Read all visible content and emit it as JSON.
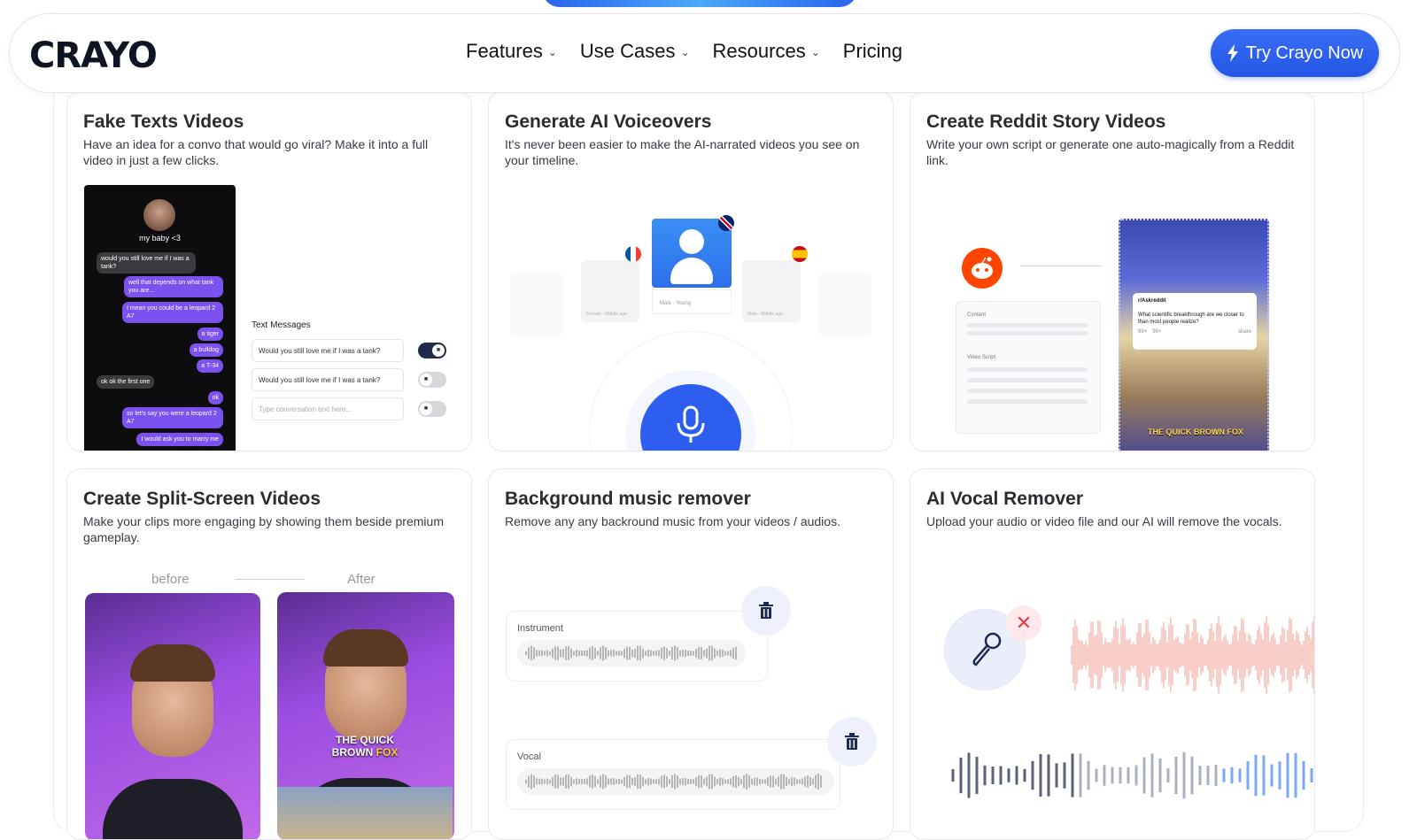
{
  "nav": {
    "logo": "CRAYO",
    "items": [
      {
        "label": "Features",
        "dropdown": true
      },
      {
        "label": "Use Cases",
        "dropdown": true
      },
      {
        "label": "Resources",
        "dropdown": true
      },
      {
        "label": "Pricing",
        "dropdown": false
      }
    ],
    "cta_label": "Try Crayo Now"
  },
  "colors": {
    "accent": "#2a5ee8",
    "reddit": "#ff4500",
    "chat_purple": "#7b52f0"
  },
  "cards": [
    {
      "title": "Fake Texts Videos",
      "desc": "Have an idea for a convo that would go viral? Make it into a full video in just a few clicks.",
      "phone": {
        "contact": "my baby <3",
        "messages": [
          {
            "side": "left",
            "text": "would you still love me if I was a tank?"
          },
          {
            "side": "right",
            "text": "well that depends on what tank you are..."
          },
          {
            "side": "right",
            "text": "I mean you could be a leopard 2 A7"
          },
          {
            "side": "right",
            "text": "a tiger"
          },
          {
            "side": "right",
            "text": "a bulldog"
          },
          {
            "side": "right",
            "text": "a T-34"
          },
          {
            "side": "left",
            "text": "ok ok the first one"
          },
          {
            "side": "right",
            "text": "ok"
          },
          {
            "side": "right",
            "text": "so let's say you were a leopard 2 A7"
          },
          {
            "side": "right",
            "text": "I would ask you to marry me"
          }
        ]
      },
      "text_messages": {
        "label": "Text Messages",
        "inputs": [
          {
            "value": "Would you still love me if I was a tank?",
            "toggle_on": true
          },
          {
            "value": "Would you still love me if I was a tank?",
            "toggle_on": false
          },
          {
            "placeholder": "Type conversation text here...",
            "toggle_on": false
          }
        ]
      }
    },
    {
      "title": "Generate AI Voiceovers",
      "desc": "It's never been easier to make the AI-narrated videos you see on your timeline.",
      "voice_label": "Male · Young",
      "ghost_labels": [
        "Female · Middle age",
        "Male · Middle age"
      ],
      "flags": [
        "uk-flag-icon",
        "france-flag-icon",
        "spain-flag-icon"
      ]
    },
    {
      "title": "Create Reddit Story Videos",
      "desc": "Write your own script or generate one auto-magically from a Reddit link.",
      "form": {
        "content_label": "Content",
        "script_label": "Video Script"
      },
      "post": {
        "subreddit": "r/Askreddit",
        "text": "What scientific breakthrough are we closer to than most people realize?",
        "upvotes": "99+",
        "comments": "99+",
        "share": "share"
      },
      "caption": "THE QUICK BROWN FOX"
    },
    {
      "title": "Create Split-Screen Videos",
      "desc": "Make your clips more engaging by showing them beside premium gameplay.",
      "before_label": "before",
      "after_label": "After",
      "caption_line1": "THE QUICK",
      "caption_line2a": "BROWN ",
      "caption_line2b": "FOX"
    },
    {
      "title": "Background music remover",
      "desc": "Remove any any backround music from your videos / audios.",
      "tracks": [
        {
          "label": "Instrument"
        },
        {
          "label": "Vocal"
        }
      ]
    },
    {
      "title": "AI Vocal Remover",
      "desc": "Upload your audio or video file and our AI will remove the vocals."
    }
  ]
}
